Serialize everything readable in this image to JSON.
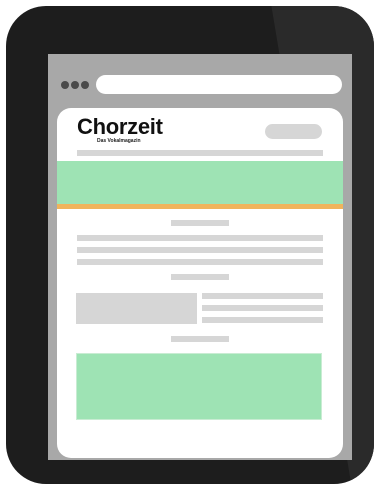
{
  "brand": {
    "title": "Chorzeit",
    "subtitle": "Das Vokalmagazin"
  },
  "colors": {
    "device": "#1d1d1d",
    "screen_gray": "#a8a8a8",
    "placeholder_gray": "#d6d6d6",
    "banner_green": "#9ee3b4",
    "accent_orange": "#f0b45c"
  },
  "icons": {
    "window_controls": "three-dots-icon"
  }
}
